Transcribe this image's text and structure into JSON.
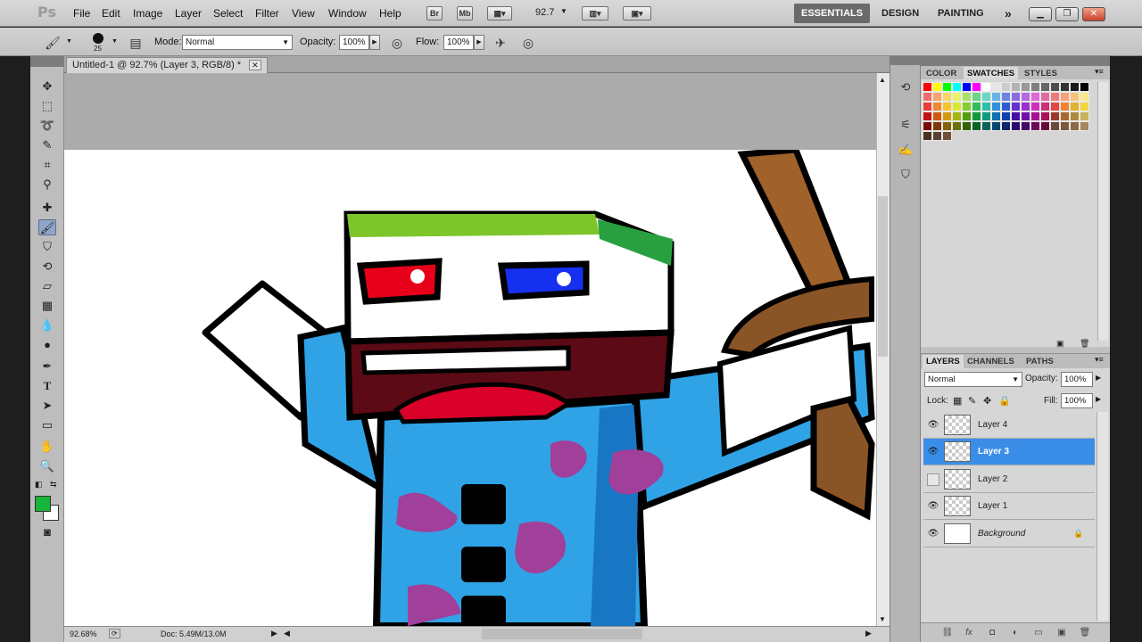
{
  "app": {
    "logo": "Ps"
  },
  "menu": [
    "File",
    "Edit",
    "Image",
    "Layer",
    "Select",
    "Filter",
    "View",
    "Window",
    "Help"
  ],
  "menubar": {
    "bridge": "Br",
    "mini_bridge": "Mb",
    "zoom": "92.7",
    "workspaces": [
      "ESSENTIALS",
      "DESIGN",
      "PAINTING"
    ],
    "more": "»"
  },
  "options": {
    "brush_size": "25",
    "mode_label": "Mode:",
    "mode_value": "Normal",
    "opacity_label": "Opacity:",
    "opacity_value": "100%",
    "flow_label": "Flow:",
    "flow_value": "100%"
  },
  "document": {
    "tab_title": "Untitled-1 @ 92.7% (Layer 3, RGB/8) *",
    "status_zoom": "92.68%",
    "status_doc": "Doc: 5.49M/13.0M"
  },
  "colors": {
    "foreground": "#17b53a",
    "background": "#ffffff"
  },
  "swatch_panel": {
    "tabs": [
      "COLOR",
      "SWATCHES",
      "STYLES"
    ],
    "active_tab": "SWATCHES"
  },
  "layers_panel": {
    "tabs": [
      "LAYERS",
      "CHANNELS",
      "PATHS"
    ],
    "blend_mode": "Normal",
    "opacity_label": "Opacity:",
    "opacity_value": "100%",
    "lock_label": "Lock:",
    "fill_label": "Fill:",
    "fill_value": "100%",
    "layers": [
      {
        "name": "Layer 4",
        "visible": true,
        "selected": false
      },
      {
        "name": "Layer 3",
        "visible": true,
        "selected": true
      },
      {
        "name": "Layer 2",
        "visible": false,
        "selected": false
      },
      {
        "name": "Layer 1",
        "visible": true,
        "selected": false
      },
      {
        "name": "Background",
        "visible": true,
        "selected": false,
        "locked": true
      }
    ]
  }
}
